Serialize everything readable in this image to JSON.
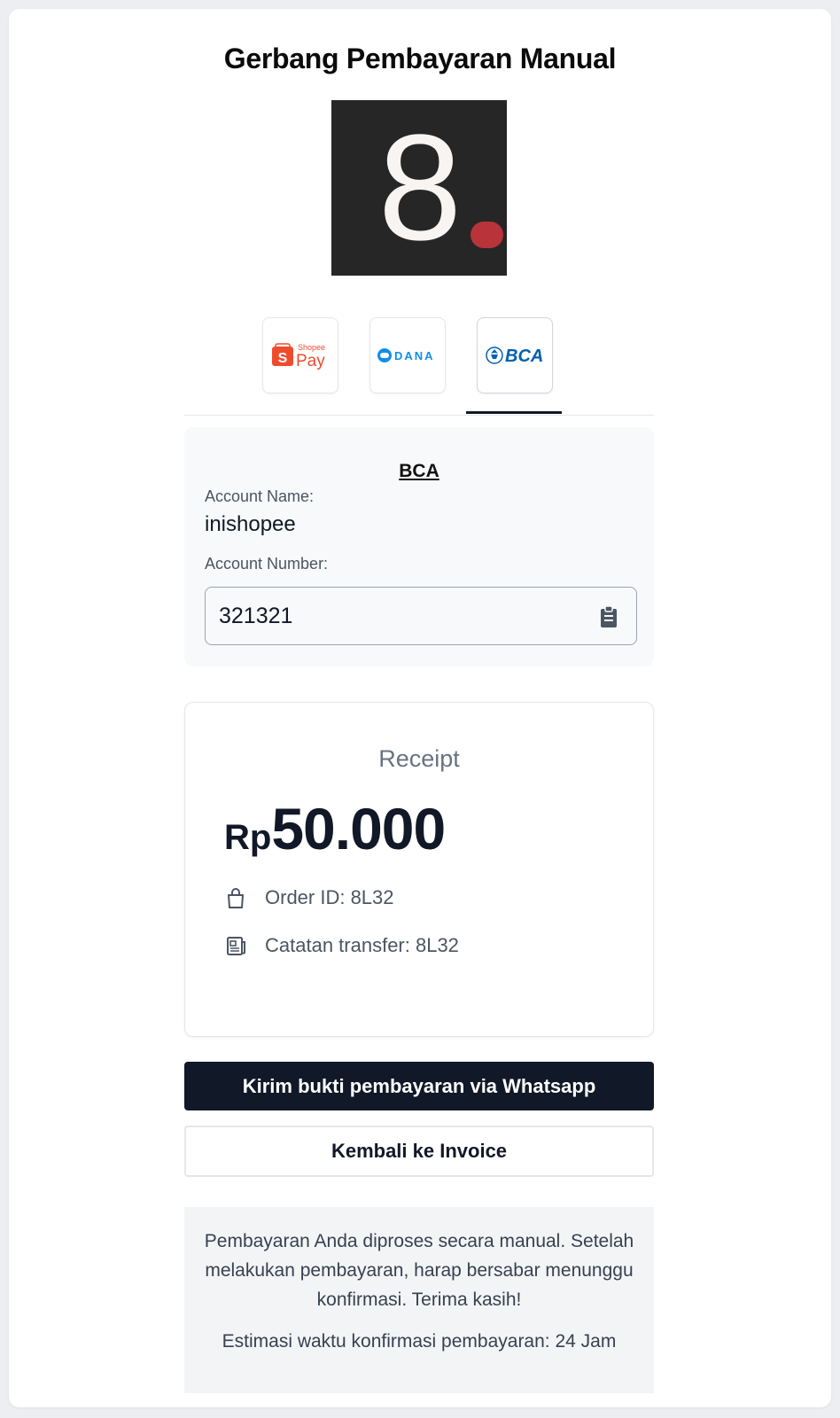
{
  "page": {
    "title": "Gerbang Pembayaran Manual"
  },
  "logo": {
    "glyph": "8",
    "dot_color": "#b8333a",
    "background": "#262626"
  },
  "methods": {
    "tabs": [
      {
        "name": "ShopeePay",
        "small": "Shopee",
        "big": "Pay",
        "icon_letter": "S",
        "active": false
      },
      {
        "name": "DANA",
        "text": "DANA",
        "active": false
      },
      {
        "name": "BCA",
        "text": "BCA",
        "active": true
      }
    ],
    "accent": "#111827"
  },
  "bank": {
    "title": "BCA",
    "account_name_label": "Account Name:",
    "account_name": "inishopee",
    "account_number_label": "Account Number:",
    "account_number": "321321"
  },
  "receipt": {
    "title": "Receipt",
    "currency": "Rp",
    "amount": "50.000",
    "order_id": "Order ID: 8L32",
    "transfer_note": "Catatan transfer: 8L32"
  },
  "actions": {
    "whatsapp_label": "Kirim bukti pembayaran via Whatsapp",
    "back_label": "Kembali ke Invoice"
  },
  "notice": {
    "message": "Pembayaran Anda diproses secara manual. Setelah melakukan pembayaran, harap bersabar menunggu konfirmasi. Terima kasih!",
    "estimate": "Estimasi waktu konfirmasi pembayaran: 24 Jam"
  }
}
